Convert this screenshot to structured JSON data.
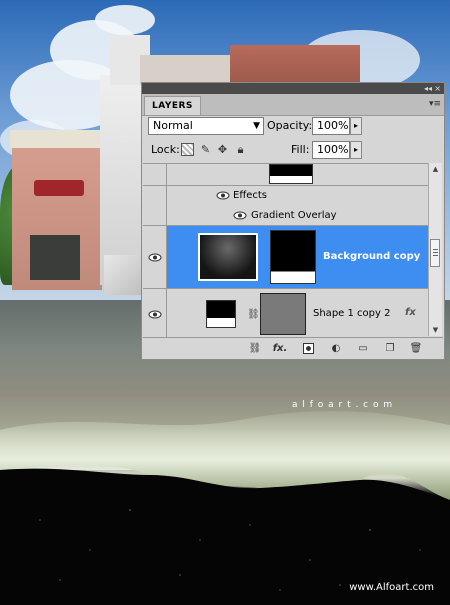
{
  "panel": {
    "tab_label": "LAYERS",
    "collapse_icon": "double-arrow-icon",
    "menu_icon": "panel-menu-icon",
    "blend_mode": "Normal",
    "opacity_label": "Opacity:",
    "opacity_value": "100%",
    "lock_label": "Lock:",
    "fill_label": "Fill:",
    "fill_value": "100%"
  },
  "layers": [
    {
      "name": "Effects",
      "type": "effects-group"
    },
    {
      "name": "Gradient Overlay",
      "type": "effect"
    },
    {
      "name": "Background copy",
      "type": "layer",
      "selected": true,
      "visible": true
    },
    {
      "name": "Shape 1 copy 2",
      "type": "shape-layer",
      "visible": true,
      "fx": "fx"
    }
  ],
  "bottom_bar": [
    "link-icon",
    "fx-icon",
    "mask-icon",
    "adjustment-icon",
    "group-folder-icon",
    "new-layer-icon",
    "trash-icon"
  ],
  "bottom_bar_fx_label": "fx.",
  "watermark_center": "a l f o a r t . c o m",
  "watermark_corner": "www.Alfoart.com"
}
